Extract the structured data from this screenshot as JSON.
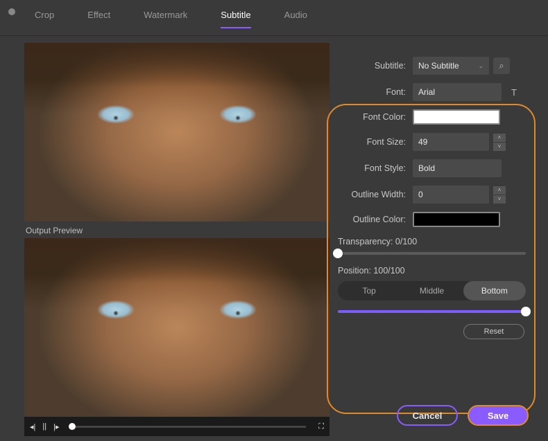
{
  "tabs": {
    "crop": "Crop",
    "effect": "Effect",
    "watermark": "Watermark",
    "subtitle": "Subtitle",
    "audio": "Audio",
    "active": "subtitle"
  },
  "preview_label": "Output Preview",
  "panel": {
    "subtitle_label": "Subtitle:",
    "subtitle_value": "No Subtitle",
    "font_label": "Font:",
    "font_value": "Arial",
    "font_color_label": "Font Color:",
    "font_color_value": "#ffffff",
    "font_size_label": "Font Size:",
    "font_size_value": "49",
    "font_style_label": "Font Style:",
    "font_style_value": "Bold",
    "outline_width_label": "Outline Width:",
    "outline_width_value": "0",
    "outline_color_label": "Outline Color:",
    "outline_color_value": "#000000",
    "transparency_label": "Transparency: 0/100",
    "transparency_value": 0,
    "position_label": "Position: 100/100",
    "position_value": 100,
    "pos_top": "Top",
    "pos_middle": "Middle",
    "pos_bottom": "Bottom",
    "pos_active": "bottom",
    "reset": "Reset"
  },
  "footer": {
    "cancel": "Cancel",
    "save": "Save"
  },
  "icons": {
    "search": "⌕",
    "text_style": "T",
    "chevron": "⌄",
    "step_prev": "◂|",
    "play_pause": "||",
    "step_next": "|▸",
    "fullscreen": "⛶",
    "up": "˄",
    "down": "˅"
  }
}
